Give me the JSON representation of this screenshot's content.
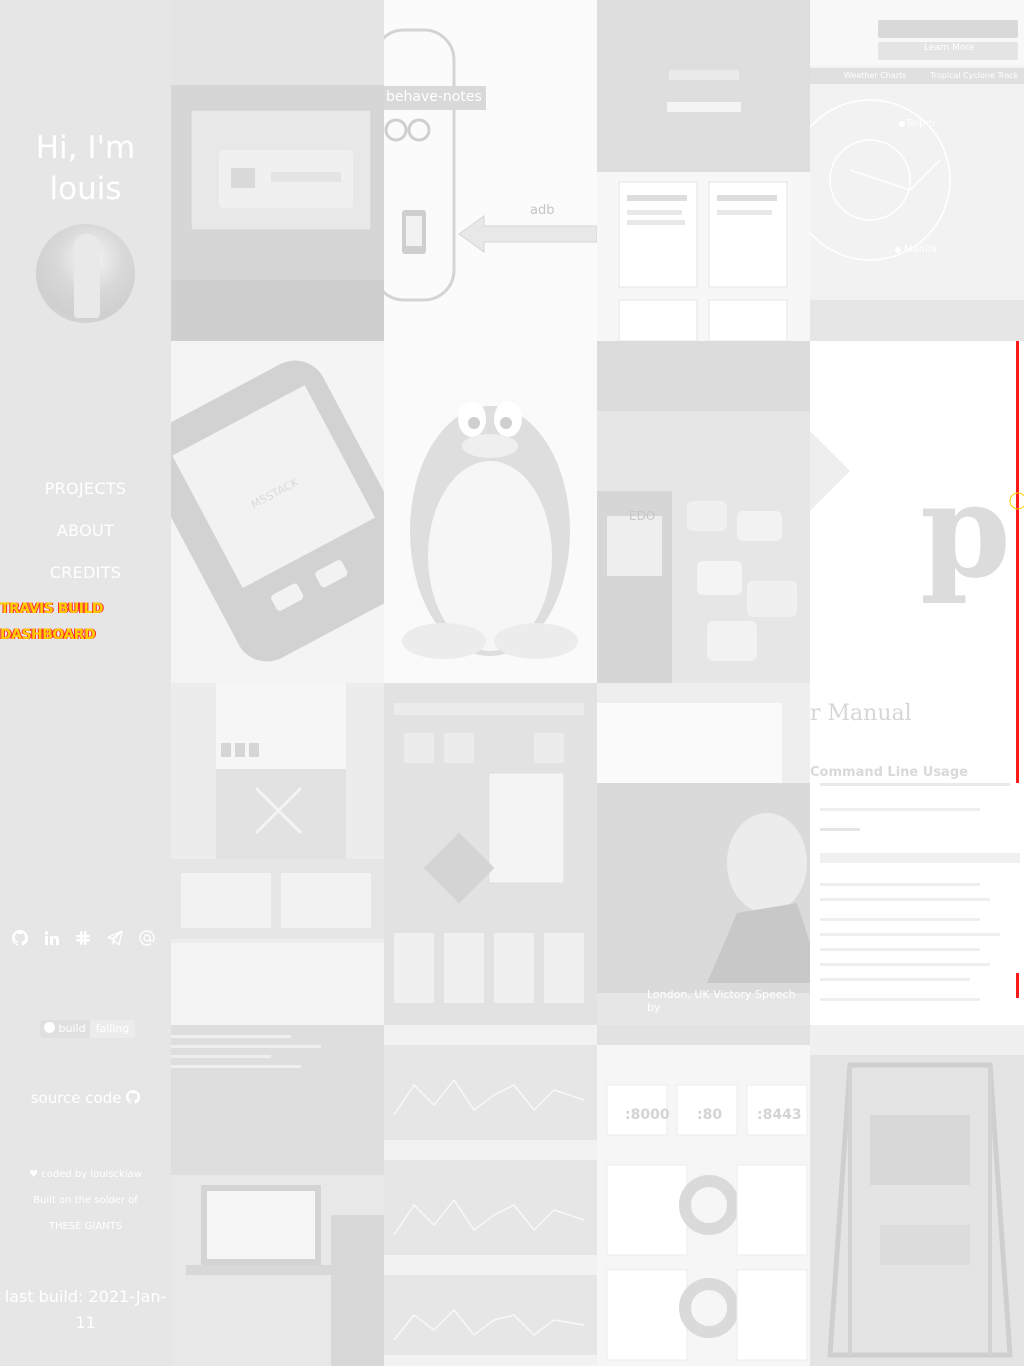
{
  "sidebar": {
    "greeting": "Hi, I'm louis",
    "nav": [
      {
        "label": "PROJECTS"
      },
      {
        "label": "ABOUT"
      },
      {
        "label": "CREDITS"
      }
    ],
    "glitch_lines": [
      "TRAVIS BUILD",
      "DASHBOARD"
    ],
    "social_icons": [
      "github-icon",
      "linkedin-icon",
      "slack-icon",
      "telegram-icon",
      "email-icon"
    ],
    "badge": {
      "label": "build",
      "status": "failing"
    },
    "source_code": "source code",
    "credit_line1": "coded by louisckiaw",
    "credit_line2": "Built on the solder of",
    "credit_line3": "THESE GIANTS",
    "last_build": "last build: 2021-Jan-11"
  },
  "tiles": {
    "behave_notes": "behave-notes",
    "adb": "adb",
    "m5stack": "M5STACK",
    "cyclone": {
      "taipei": "Taipei",
      "manila": "Manila",
      "weather": "Weather Charts",
      "track": "Tropical Cyclone Track",
      "learn": "Learn More"
    },
    "manual": {
      "title": "r Manual",
      "subtitle": "Command Line Usage"
    },
    "ports": [
      ":8000",
      ":80",
      ":8443"
    ],
    "speech": "London, UK  Victory Speech by",
    "traffic": "EDO"
  }
}
